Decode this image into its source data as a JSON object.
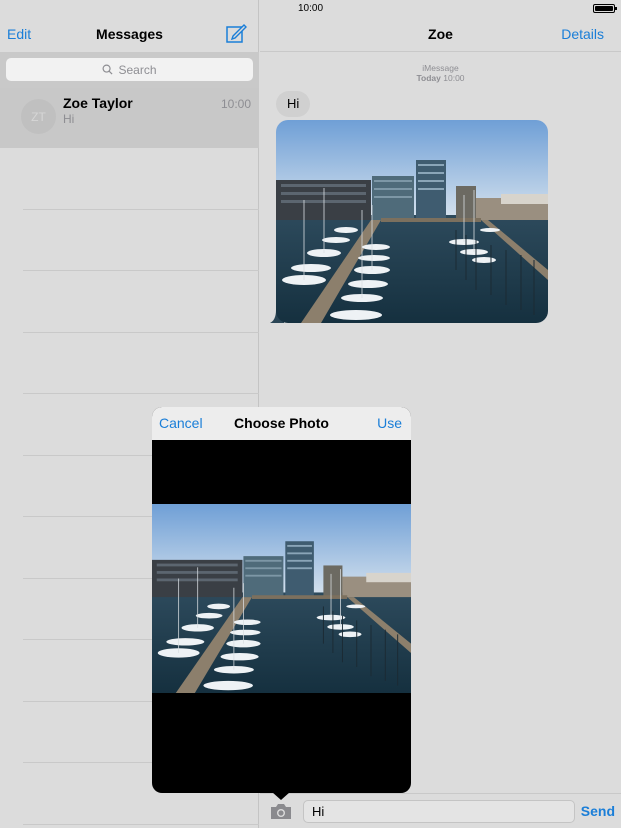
{
  "status_bar": {
    "time": "10:00"
  },
  "sidebar": {
    "edit_label": "Edit",
    "title": "Messages",
    "search_placeholder": "Search",
    "conversations": [
      {
        "initials": "ZT",
        "name": "Zoe Taylor",
        "preview": "Hi",
        "time": "10:00"
      }
    ]
  },
  "conversation": {
    "title": "Zoe",
    "details_label": "Details",
    "service": "iMessage",
    "timestamp_day": "Today",
    "timestamp_time": "10:00",
    "messages": [
      {
        "text": "Hi"
      }
    ]
  },
  "input_bar": {
    "value": "Hi",
    "send_label": "Send"
  },
  "photo_picker": {
    "cancel_label": "Cancel",
    "title": "Choose Photo",
    "use_label": "Use"
  },
  "colors": {
    "accent": "#1a7ed8",
    "background": "#dcdcdc",
    "selected_row": "#c8c8c8"
  }
}
